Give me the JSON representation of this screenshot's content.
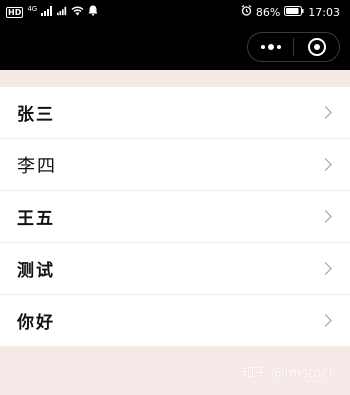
{
  "status_bar": {
    "left_badge": "HD",
    "signal_label": "4G",
    "battery_percent": "86%",
    "time": "17:03"
  },
  "capsule": {
    "more_icon": "more-dots-icon",
    "close_icon": "target-icon"
  },
  "list": {
    "items": [
      {
        "label": "张三"
      },
      {
        "label": "李四"
      },
      {
        "label": "王五"
      },
      {
        "label": "测试"
      },
      {
        "label": "你好"
      }
    ]
  },
  "watermark": "知乎 @fmstock"
}
